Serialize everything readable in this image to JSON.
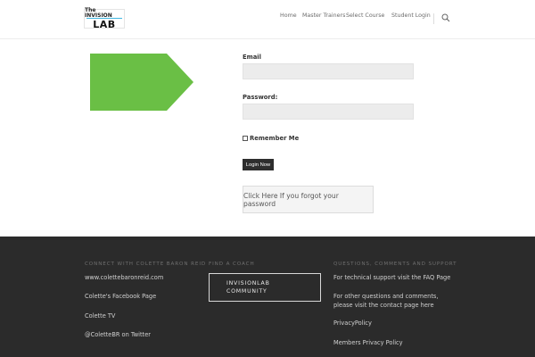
{
  "logo": {
    "line1": "The INVISION",
    "line2": "LAB"
  },
  "nav": {
    "items": [
      {
        "label": "Home"
      },
      {
        "label": "Master Trainers"
      },
      {
        "label": "Select Course"
      },
      {
        "label": "Student Login"
      }
    ],
    "search_icon": "search-icon"
  },
  "colors": {
    "arrow": "#6abf45",
    "footer_bg": "#2b2b2b",
    "button_bg": "#2e2e2e"
  },
  "form": {
    "email_label": "Email",
    "email_value": "",
    "password_label": "Password:",
    "password_value": "",
    "remember_label": "Remember Me",
    "remember_checked": false,
    "login_label": "Login Now",
    "forgot_label": "Click Here If you forgot your password"
  },
  "footer": {
    "connect": {
      "heading": "CONNECT WITH COLETTE BARON REID",
      "links": [
        {
          "label": "www.colettebaronreid.com"
        },
        {
          "label": "Colette's Facebook Page"
        },
        {
          "label": "Colette TV"
        },
        {
          "label": "@ColetteBR on Twitter"
        }
      ]
    },
    "coach": {
      "heading": "FIND A COACH",
      "box_line1": "INVISIONLAB",
      "box_line2": "COMMUNITY"
    },
    "questions": {
      "heading": "QUESTIONS, COMMENTS AND SUPPORT",
      "links": [
        {
          "label": "For technical support visit the FAQ Page"
        },
        {
          "label": "For other questions and comments, please visit the contact page here"
        },
        {
          "label": "PrivacyPolicy"
        },
        {
          "label": "Members Privacy Policy"
        }
      ]
    }
  }
}
